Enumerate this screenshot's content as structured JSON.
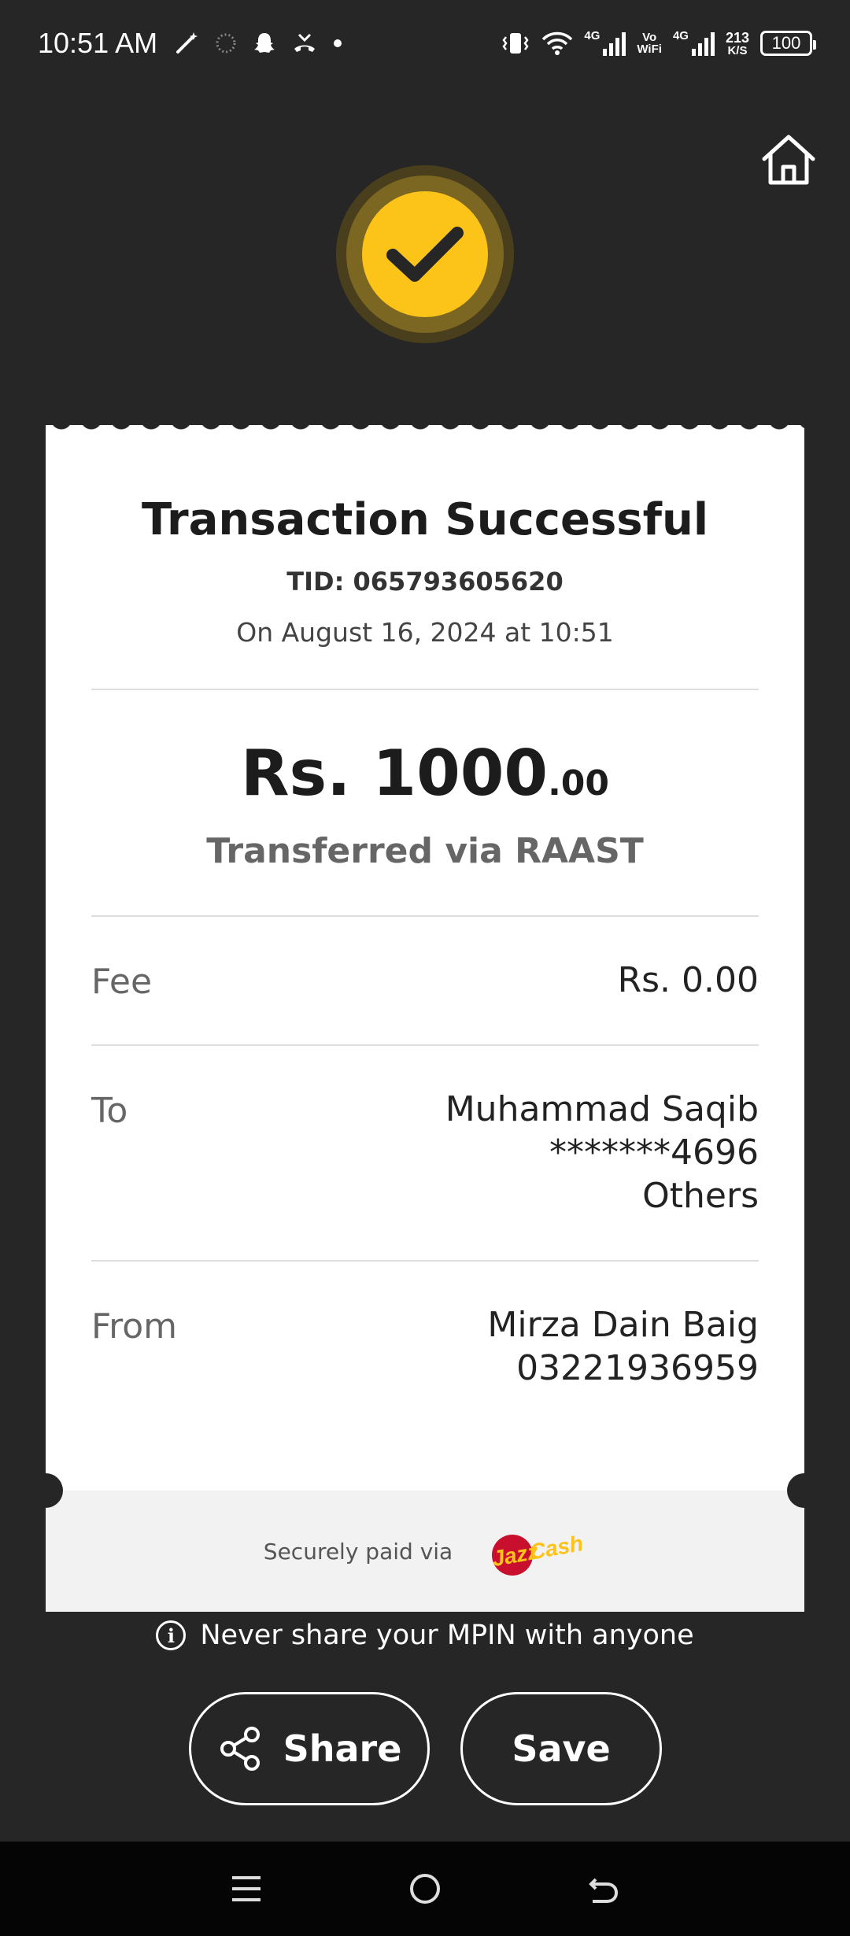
{
  "status_bar": {
    "time": "10:51 AM",
    "net1": "4G",
    "vowifi_top": "Vo",
    "vowifi_bottom": "WiFi",
    "net2": "4G",
    "speed_value": "213",
    "speed_unit": "K/S",
    "battery": "100"
  },
  "icons": {
    "home": "home-icon",
    "check": "checkmark-icon",
    "share": "share-icon",
    "info": "info-icon"
  },
  "colors": {
    "background": "#262626",
    "accent": "#fcc319",
    "card": "#ffffff",
    "footer": "#f2f2f2"
  },
  "receipt": {
    "title": "Transaction Successful",
    "tid": "TID: 065793605620",
    "date": "On August 16, 2024 at 10:51",
    "amount_main": "Rs. 1000",
    "amount_cents": ".00",
    "method": "Transferred via RAAST",
    "fee_label": "Fee",
    "fee_value": "Rs. 0.00",
    "to_label": "To",
    "to_name": "Muhammad Saqib",
    "to_account": "*******4696",
    "to_bank": "Others",
    "from_label": "From",
    "from_name": "Mirza Dain Baig",
    "from_number": "03221936959",
    "secure_text": "Securely paid via",
    "logo_text_jazz": "Jazz",
    "logo_text_cash": "Cash"
  },
  "notice": "Never share your MPIN with anyone",
  "buttons": {
    "share": "Share",
    "save": "Save"
  }
}
